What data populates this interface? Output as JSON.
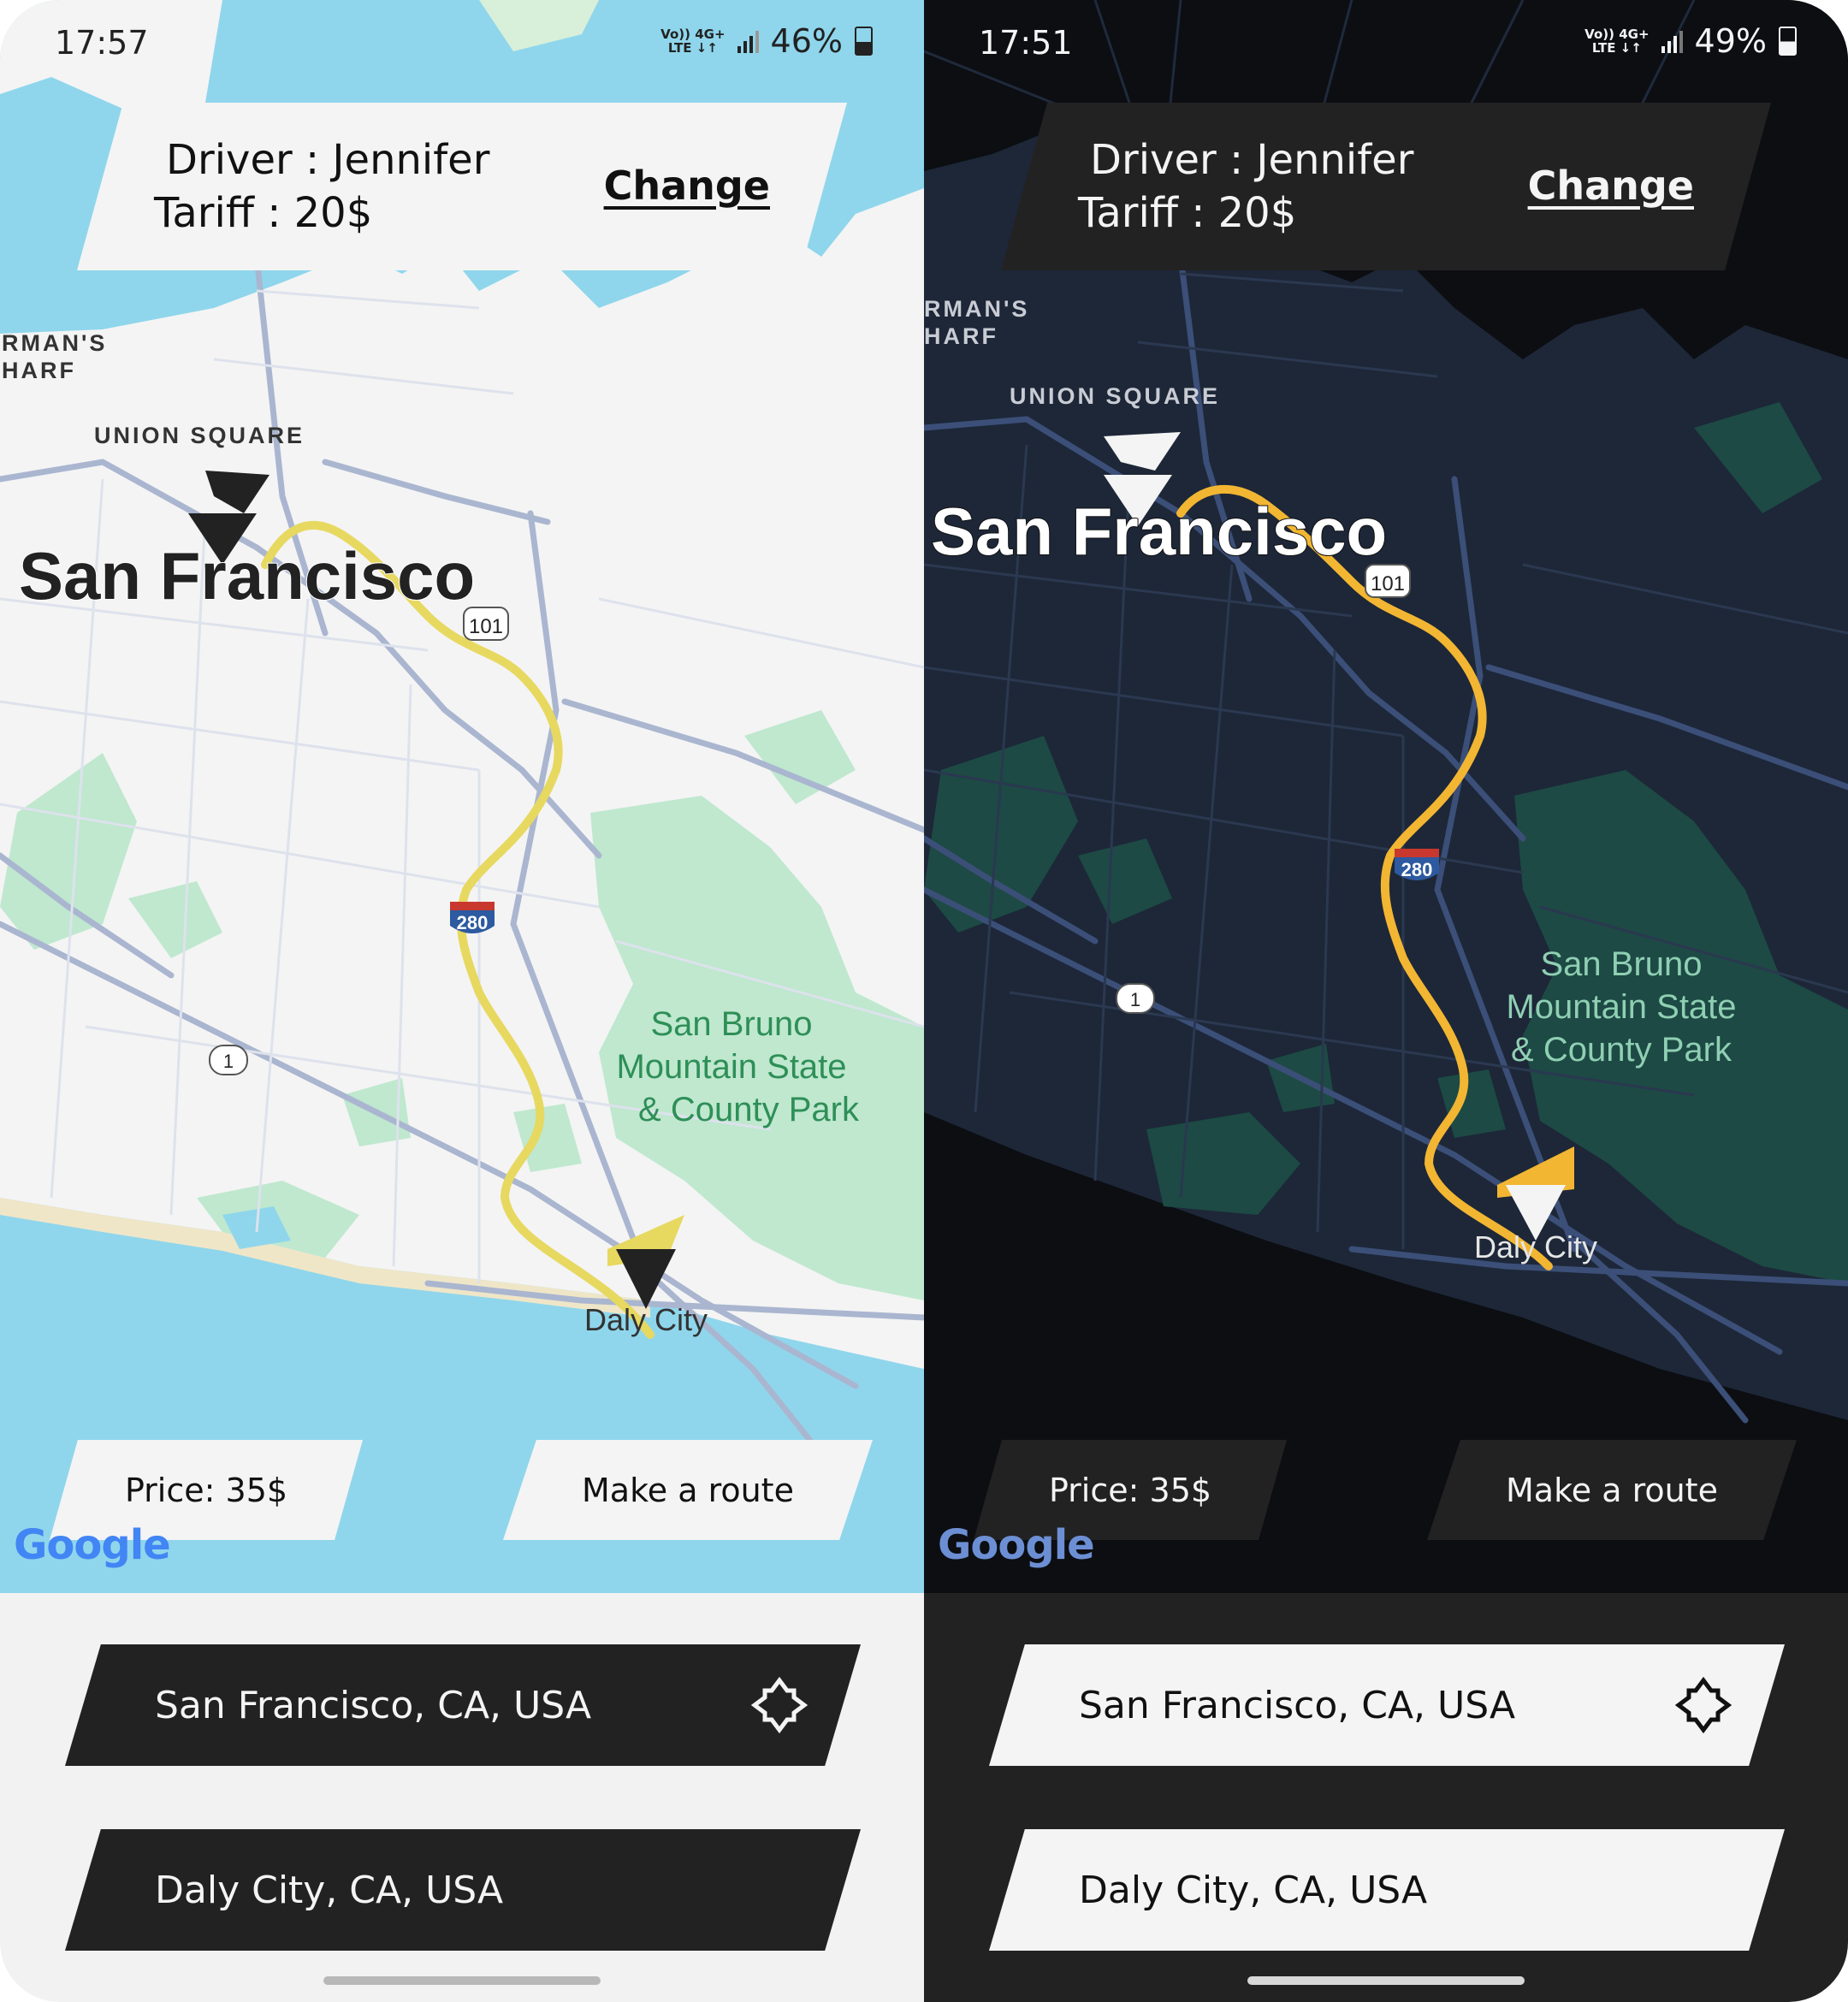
{
  "screens": [
    {
      "theme": "light",
      "status_bar": {
        "time": "17:57",
        "network_top": "Vo)) 4G+",
        "network_bottom": "LTE ↓↑",
        "battery": "46%"
      },
      "driver_card": {
        "driver_line": "Driver : Jennifer",
        "tariff_line": "Tariff : 20$",
        "change_label": "Change"
      },
      "map": {
        "city_label": "San Francisco",
        "district_label": "UNION SQUARE",
        "wharf_label_1": "RMAN'S",
        "wharf_label_2": "HARF",
        "park_label": [
          "San Bruno",
          "Mountain State",
          "& County Park"
        ],
        "destination_label": "Daly City",
        "highway_shields": [
          "101",
          "280",
          "1"
        ],
        "logo": "Google"
      },
      "price_label": "Price: 35$",
      "route_button_label": "Make a route",
      "from_address": "San Francisco, CA, USA",
      "to_address": "Daly City, CA, USA"
    },
    {
      "theme": "dark",
      "status_bar": {
        "time": "17:51",
        "network_top": "Vo)) 4G+",
        "network_bottom": "LTE ↓↑",
        "battery": "49%"
      },
      "driver_card": {
        "driver_line": "Driver : Jennifer",
        "tariff_line": "Tariff : 20$",
        "change_label": "Change"
      },
      "map": {
        "city_label": "San Francisco",
        "district_label": "UNION SQUARE",
        "wharf_label_1": "RMAN'S",
        "wharf_label_2": "HARF",
        "park_label": [
          "San Bruno",
          "Mountain State",
          "& County Park"
        ],
        "destination_label": "Daly City",
        "highway_shields": [
          "101",
          "280",
          "1"
        ],
        "logo": "Google"
      },
      "price_label": "Price: 35$",
      "route_button_label": "Make a route",
      "from_address": "San Francisco, CA, USA",
      "to_address": "Daly City, CA, USA"
    }
  ],
  "colors": {
    "light_water": "#8fd6ec",
    "light_land": "#f4f4f4",
    "light_park": "#bfe8cf",
    "light_road": "#aab6d0",
    "light_route": "#e7d860",
    "light_card": "#f4f4f4",
    "light_input_bg": "#222222",
    "dark_water": "#0c0e12",
    "dark_land": "#1d2738",
    "dark_park": "#1d4a44",
    "dark_road": "#3b4f78",
    "dark_route": "#f2b632",
    "dark_card": "#222222",
    "dark_input_bg": "#f4f4f4"
  },
  "icons": {
    "start_marker": "navigation-arrow-icon",
    "end_marker": "destination-arrow-icon",
    "swap": "swap-diamond-icon",
    "battery": "battery-icon",
    "signal": "signal-bars-icon"
  }
}
